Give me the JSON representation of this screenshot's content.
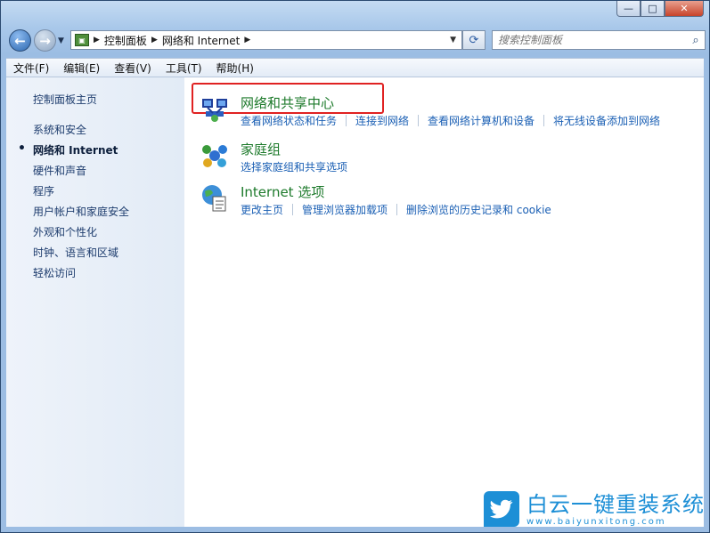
{
  "window": {
    "minimize": "—",
    "maximize": "□",
    "close": "✕"
  },
  "address": {
    "segments": [
      "控制面板",
      "网络和 Internet"
    ]
  },
  "search": {
    "placeholder": "搜索控制面板"
  },
  "menu": [
    "文件(F)",
    "编辑(E)",
    "查看(V)",
    "工具(T)",
    "帮助(H)"
  ],
  "sidebar": {
    "home": "控制面板主页",
    "items": [
      "系统和安全",
      "网络和 Internet",
      "硬件和声音",
      "程序",
      "用户帐户和家庭安全",
      "外观和个性化",
      "时钟、语言和区域",
      "轻松访问"
    ],
    "active_index": 1
  },
  "categories": [
    {
      "title": "网络和共享中心",
      "icon": "network-sharing-center-icon",
      "links": [
        "查看网络状态和任务",
        "连接到网络",
        "查看网络计算机和设备",
        "将无线设备添加到网络"
      ]
    },
    {
      "title": "家庭组",
      "icon": "homegroup-icon",
      "links": [
        "选择家庭组和共享选项"
      ]
    },
    {
      "title": "Internet 选项",
      "icon": "internet-options-icon",
      "links": [
        "更改主页",
        "管理浏览器加载项",
        "删除浏览的历史记录和 cookie"
      ]
    }
  ],
  "watermark": {
    "brand": "白云一键重装系统",
    "url": "www.baiyunxitong.com"
  },
  "colors": {
    "link": "#1a5fb4",
    "category_title": "#1d7a2b",
    "highlight": "#e02222"
  }
}
